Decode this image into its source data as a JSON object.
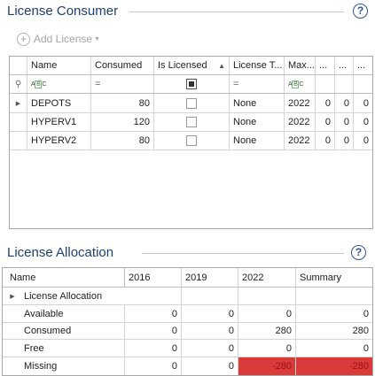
{
  "license_consumer": {
    "title": "License Consumer",
    "help_label": "?",
    "add_license_label": "Add License",
    "columns": [
      "Name",
      "Consumed",
      "Is Licensed",
      "License T...",
      "Max...",
      "...",
      "...",
      "..."
    ],
    "rows": [
      {
        "name": "DEPOTS",
        "consumed": "80",
        "license_type": "None",
        "max": "2022",
        "c6": "0",
        "c7": "0",
        "c8": "0"
      },
      {
        "name": "HYPERV1",
        "consumed": "120",
        "license_type": "None",
        "max": "2022",
        "c6": "0",
        "c7": "0",
        "c8": "0"
      },
      {
        "name": "HYPERV2",
        "consumed": "80",
        "license_type": "None",
        "max": "2022",
        "c6": "0",
        "c7": "0",
        "c8": "0"
      }
    ]
  },
  "license_allocation": {
    "title": "License Allocation",
    "help_label": "?",
    "columns": [
      "Name",
      "2016",
      "2019",
      "2022",
      "Summary"
    ],
    "group_label": "License Allocation",
    "rows": [
      {
        "name": "Available",
        "v2016": "0",
        "v2019": "0",
        "v2022": "0",
        "summary": "0"
      },
      {
        "name": "Consumed",
        "v2016": "0",
        "v2019": "0",
        "v2022": "280",
        "summary": "280"
      },
      {
        "name": "Free",
        "v2016": "0",
        "v2019": "0",
        "v2022": "0",
        "summary": "0"
      },
      {
        "name": "Missing",
        "v2016": "0",
        "v2019": "0",
        "v2022": "-280",
        "summary": "-280"
      }
    ],
    "missing_color": "#d93a3a"
  }
}
